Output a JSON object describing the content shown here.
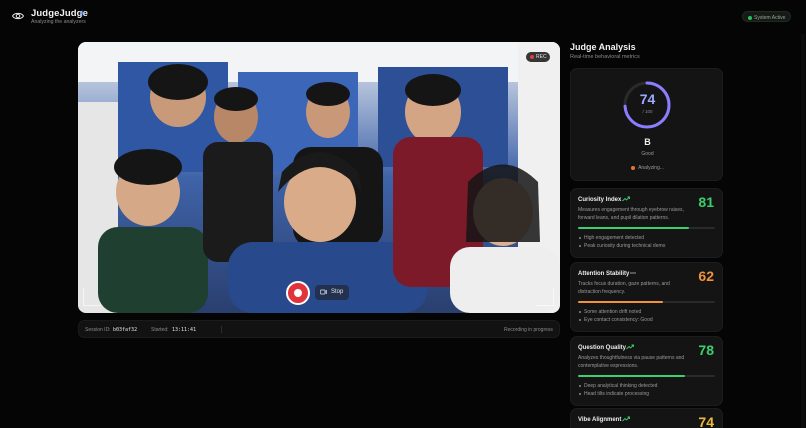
{
  "header": {
    "title": "JudgeJudge",
    "subtitle": "Analyzing the analyzers",
    "status": "System Active"
  },
  "video": {
    "rec_label": "REC",
    "stop_label": "Stop"
  },
  "session": {
    "id_label": "Session ID:",
    "id_value": "b03faf32",
    "started_label": "Started:",
    "started_value": "13:11:41",
    "recording_status": "Recording in progress"
  },
  "panel": {
    "title": "Judge Analysis",
    "subtitle": "Real-time behavioral metrics"
  },
  "overall": {
    "score": "74",
    "max": "/ 100",
    "score_fraction": 0.74,
    "grade": "B",
    "grade_word": "Good",
    "status": "Analyzing..."
  },
  "metrics": [
    {
      "title": "Curiosity Index",
      "score": "81",
      "progress": 0.81,
      "color": "#3ccf6e",
      "trend": "trend-up",
      "description": "Measures engagement through eyebrow raises, forward leans, and pupil dilation patterns.",
      "bullets": [
        "High engagement detected",
        "Peak curiosity during technical demo"
      ]
    },
    {
      "title": "Attention Stability",
      "score": "62",
      "progress": 0.62,
      "color": "#f0933a",
      "trend": "trend-flat",
      "description": "Tracks focus duration, gaze patterns, and distraction frequency.",
      "bullets": [
        "Some attention drift noted",
        "Eye contact consistency: Good"
      ]
    },
    {
      "title": "Question Quality",
      "score": "78",
      "progress": 0.78,
      "color": "#3ccf6e",
      "trend": "trend-up",
      "description": "Analyzes thoughtfulness via pause patterns and contemplative expressions.",
      "bullets": [
        "Deep analytical thinking detected",
        "Head tilts indicate processing"
      ]
    },
    {
      "title": "Vibe Alignment",
      "score": "74",
      "color": "#f0b93a",
      "trend": "trend-up"
    }
  ]
}
